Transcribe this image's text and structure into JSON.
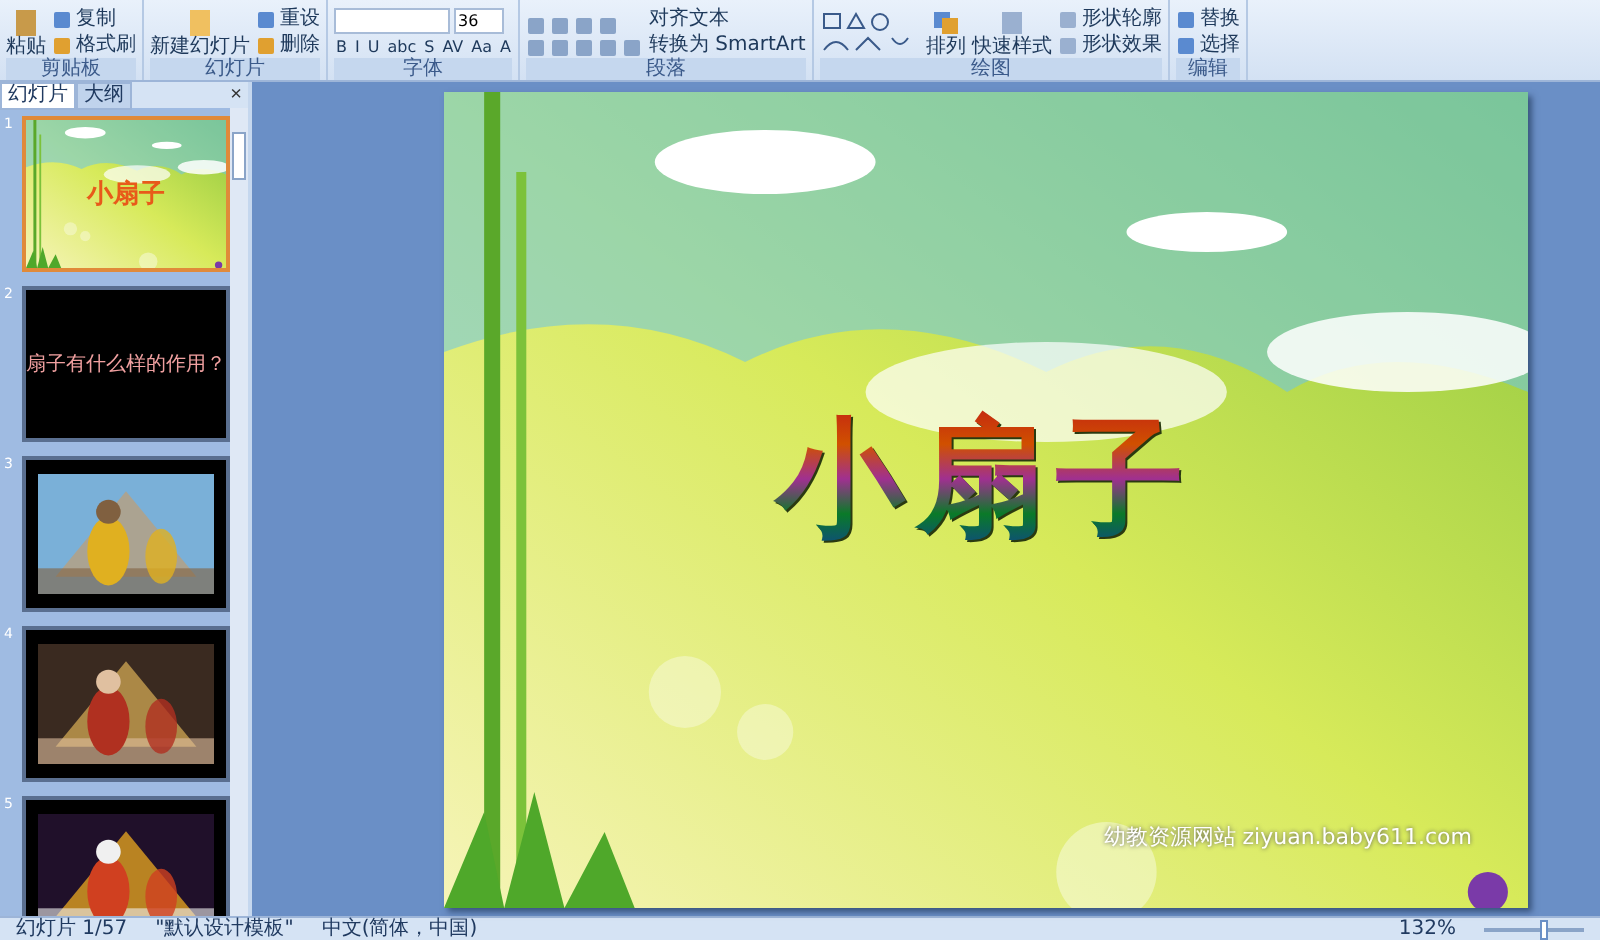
{
  "ribbon": {
    "groups": [
      {
        "label": "剪贴板",
        "kind": "clipboard",
        "big": "粘贴",
        "items": [
          "复制",
          "格式刷"
        ]
      },
      {
        "label": "幻灯片",
        "kind": "slides",
        "big": "新建幻灯片",
        "items": [
          "重设",
          "删除"
        ]
      },
      {
        "label": "字体",
        "kind": "font",
        "font_size": "36",
        "items": [
          "B",
          "I",
          "U",
          "abc",
          "S",
          "AV",
          "Aa",
          "A"
        ]
      },
      {
        "label": "段落",
        "kind": "paragraph",
        "items": [
          "对齐文本",
          "转换为 SmartArt"
        ]
      },
      {
        "label": "绘图",
        "kind": "drawing",
        "big": "排列",
        "items": [
          "快速样式",
          "形状轮廓",
          "形状效果"
        ]
      },
      {
        "label": "编辑",
        "kind": "editing",
        "items": [
          "替换",
          "选择"
        ]
      }
    ]
  },
  "panel": {
    "tabs": [
      {
        "label": "幻灯片",
        "selected": true
      },
      {
        "label": "大纲",
        "selected": false
      }
    ],
    "close": "×",
    "slides": [
      {
        "number": "1",
        "kind": "title",
        "title": "小扇子",
        "selected": true
      },
      {
        "number": "2",
        "kind": "text",
        "text": "扇子有什么样的作用？",
        "selected": false
      },
      {
        "number": "3",
        "kind": "picture",
        "selected": false
      },
      {
        "number": "4",
        "kind": "picture",
        "selected": false
      },
      {
        "number": "5",
        "kind": "picture",
        "selected": false
      }
    ]
  },
  "slide": {
    "title": "小扇子",
    "footer": "幼教资源网站  ziyuan.baby611.com"
  },
  "status_bar": {
    "items": [
      "幻灯片 1/57",
      "\"默认设计模板\"",
      "中文(简体，中国)"
    ],
    "zoom": "132%",
    "zoom_slider": {
      "level": 0.6
    }
  }
}
